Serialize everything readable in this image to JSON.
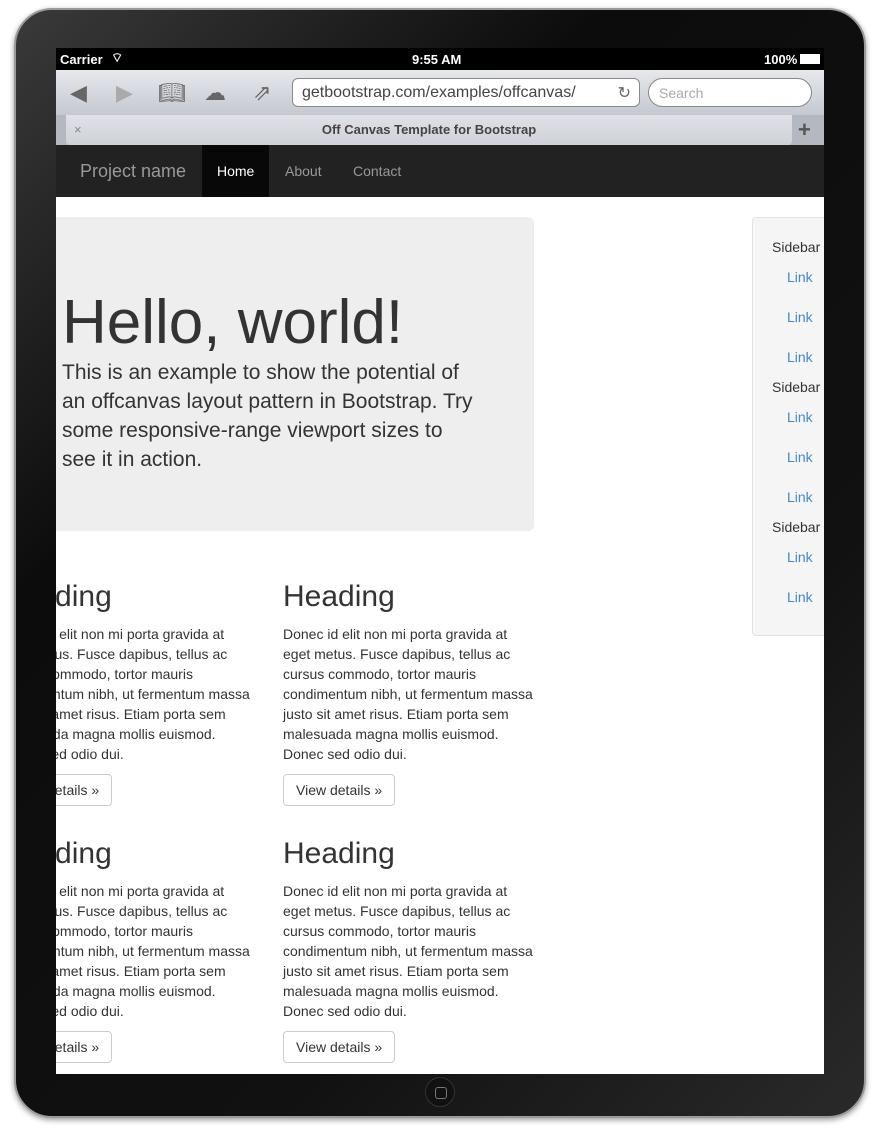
{
  "status": {
    "carrier": "Carrier",
    "time": "9:55 AM",
    "battery": "100%"
  },
  "browser": {
    "url": "getbootstrap.com/examples/offcanvas/",
    "search_placeholder": "Search",
    "tab_title": "Off Canvas Template for Bootstrap",
    "close_tab": "×",
    "new_tab": "+"
  },
  "navbar": {
    "brand": "Project name",
    "items": [
      {
        "label": "Home",
        "active": true
      },
      {
        "label": "About"
      },
      {
        "label": "Contact"
      }
    ]
  },
  "jumbotron": {
    "title": "Hello, world!",
    "text": "This is an example to show the potential of an offcanvas layout pattern in Bootstrap. Try some responsive-range viewport sizes to see it in action."
  },
  "cards": [
    {
      "heading": "Heading",
      "text": "Donec id elit non mi porta gravida at eget metus. Fusce dapibus, tellus ac cursus commodo, tortor mauris condimentum nibh, ut fermentum massa justo sit amet risus. Etiam porta sem malesuada magna mollis euismod. Donec sed odio dui.",
      "button": "View details »"
    },
    {
      "heading": "Heading",
      "text": "Donec id elit non mi porta gravida at eget metus. Fusce dapibus, tellus ac cursus commodo, tortor mauris condimentum nibh, ut fermentum massa justo sit amet risus. Etiam porta sem malesuada magna mollis euismod. Donec sed odio dui.",
      "button": "View details »"
    },
    {
      "heading": "Heading",
      "text": "Donec id elit non mi porta gravida at eget metus. Fusce dapibus, tellus ac cursus commodo, tortor mauris condimentum nibh, ut fermentum massa justo sit amet risus. Etiam porta sem malesuada magna mollis euismod. Donec sed odio dui.",
      "button": "View details »"
    },
    {
      "heading": "Heading",
      "text": "Donec id elit non mi porta gravida at eget metus. Fusce dapibus, tellus ac cursus commodo, tortor mauris condimentum nibh, ut fermentum massa justo sit amet risus. Etiam porta sem malesuada magna mollis euismod. Donec sed odio dui.",
      "button": "View details »"
    }
  ],
  "sidebar": {
    "header": "Sidebar",
    "link": "Link"
  },
  "colors": {
    "navbar": "#222222",
    "link": "#428bca",
    "jumbotron": "#eeeeee"
  }
}
